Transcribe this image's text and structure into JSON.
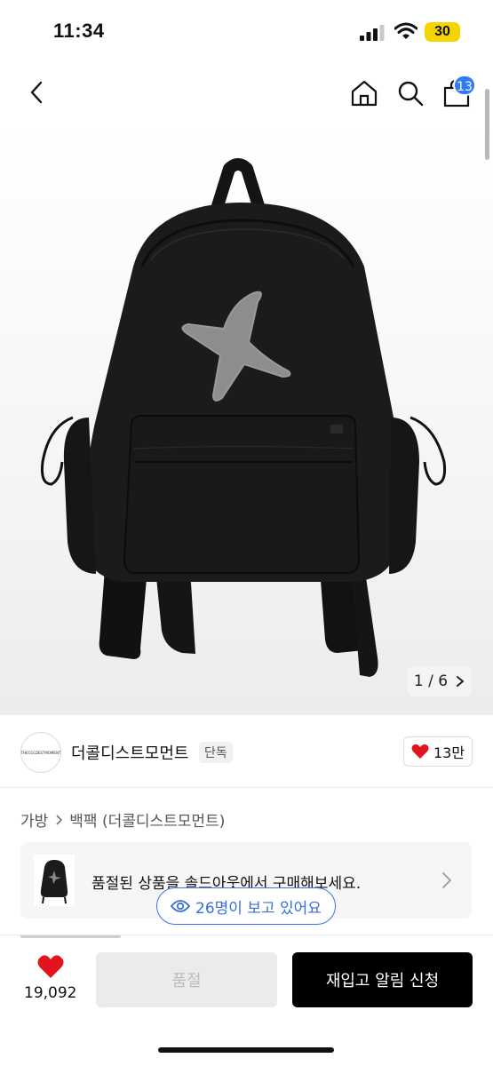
{
  "status": {
    "time": "11:34",
    "battery": "30"
  },
  "header": {
    "cart_count": "13"
  },
  "gallery": {
    "pager": "1 / 6"
  },
  "brand": {
    "name": "더콜디스트모먼트",
    "tag": "단독",
    "likes": "13만"
  },
  "breadcrumb": {
    "category": "가방",
    "subcategory": "백팩 (더콜디스트모먼트)"
  },
  "soldout_banner": {
    "text": "품절된 상품을 솔드아웃에서 구매해보세요."
  },
  "viewers": {
    "text": "26명이 보고 있어요"
  },
  "bottom_bar": {
    "like_count": "19,092",
    "soldout_label": "품절",
    "restock_label": "재입고 알림 신청"
  },
  "colors": {
    "accent_blue": "#2f7bf6",
    "heart_red": "#e3141f",
    "battery_yellow": "#f5d400",
    "primary_button": "#000000"
  }
}
